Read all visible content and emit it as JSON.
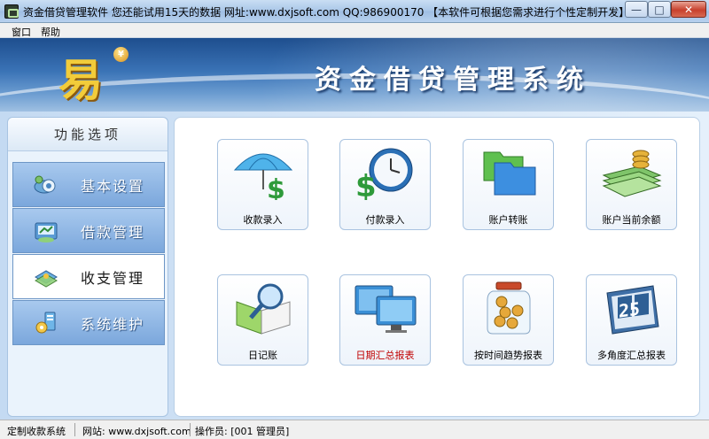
{
  "window": {
    "title": "资金借贷管理软件  您还能试用15天的数据   网址:www.dxjsoft.com  QQ:986900170  【本软件可根据您需求进行个性定制开发】",
    "minimize_glyph": "—",
    "maximize_glyph": "□",
    "close_glyph": "✕"
  },
  "menu": {
    "items": [
      "窗口",
      "帮助"
    ]
  },
  "banner": {
    "logo_glyph": "易",
    "coin_glyph": "¥",
    "title": "资金借贷管理系统"
  },
  "sidebar": {
    "header": "功能选项",
    "items": [
      {
        "label": "基本设置",
        "icon": "settings-icon",
        "active": false
      },
      {
        "label": "借款管理",
        "icon": "loan-icon",
        "active": false
      },
      {
        "label": "收支管理",
        "icon": "income-expense-icon",
        "active": true
      },
      {
        "label": "系统维护",
        "icon": "maintenance-icon",
        "active": false
      }
    ]
  },
  "tiles": [
    {
      "label": "收款录入",
      "icon": "umbrella-dollar-icon"
    },
    {
      "label": "付款录入",
      "icon": "clock-dollar-icon"
    },
    {
      "label": "账户转账",
      "icon": "folders-icon"
    },
    {
      "label": "账户当前余额",
      "icon": "money-stack-icon"
    },
    {
      "label": "日记账",
      "icon": "book-magnifier-icon"
    },
    {
      "label": "日期汇总报表",
      "icon": "monitors-icon",
      "highlight": true
    },
    {
      "label": "按时间趋势报表",
      "icon": "coin-jar-icon"
    },
    {
      "label": "多角度汇总报表",
      "icon": "calendar-25-icon",
      "calendar_day": "25"
    }
  ],
  "status": {
    "left": "定制收款系统",
    "site": "网站: www.dxjsoft.com",
    "operator": "操作员: [001 管理员]"
  }
}
